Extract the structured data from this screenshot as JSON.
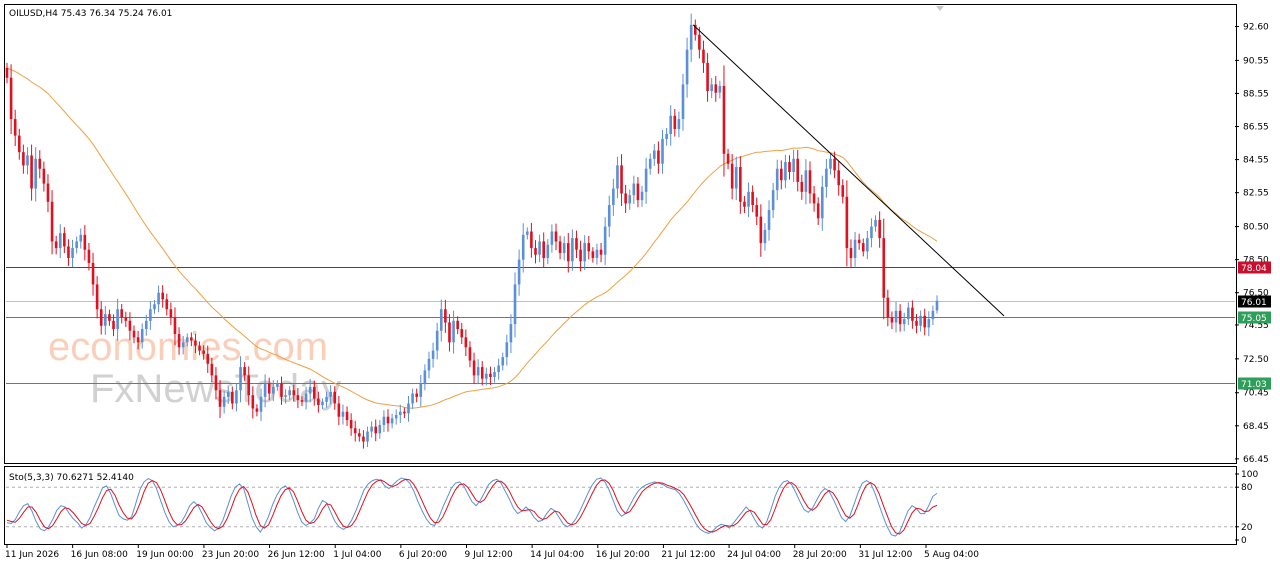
{
  "header": {
    "symbol_text": "OILUSD,H4  75.43 76.34 75.24 76.01"
  },
  "watermark": {
    "line1": "economies.com",
    "line2": "FxNewsToday"
  },
  "chart_data": {
    "type": "candlestick",
    "symbol": "OILUSD",
    "timeframe": "H4",
    "ohlc_last": {
      "open": 75.43,
      "high": 76.34,
      "low": 75.24,
      "close": 76.01
    },
    "y_ticks": [
      "92.60",
      "90.55",
      "88.55",
      "86.55",
      "84.55",
      "82.55",
      "80.50",
      "78.50",
      "76.50",
      "74.55",
      "72.50",
      "70.45",
      "68.45",
      "66.45"
    ],
    "ylim": [
      66.2,
      93.9
    ],
    "x_ticks": [
      "11 Jun 2026",
      "16 Jun 08:00",
      "19 Jun 00:00",
      "23 Jun 20:00",
      "26 Jun 12:00",
      "1 Jul 04:00",
      "6 Jul 20:00",
      "9 Jul 12:00",
      "14 Jul 04:00",
      "16 Jul 20:00",
      "21 Jul 12:00",
      "24 Jul 04:00",
      "28 Jul 20:00",
      "31 Jul 12:00",
      "5 Aug 04:00"
    ],
    "price_levels": [
      {
        "label": "78.04",
        "value": 78.04,
        "color": "#c8102e"
      },
      {
        "label": "76.01",
        "value": 76.01,
        "color": "#000000"
      },
      {
        "label": "75.05",
        "value": 75.05,
        "color": "#2e9e5b"
      },
      {
        "label": "71.03",
        "value": 71.03,
        "color": "#2e9e5b"
      }
    ],
    "trendline": {
      "from": [
        "21 Jul 12:00",
        92.7
      ],
      "to": [
        "5 Aug 04:00",
        75.1
      ],
      "color": "#000000"
    },
    "moving_average": {
      "color": "#f0a040"
    },
    "up_color": "#5b8fd8",
    "down_color": "#e0101e",
    "closes": [
      89.5,
      87.0,
      86.0,
      85.0,
      84.2,
      84.8,
      82.8,
      84.6,
      84.0,
      83.1,
      82.0,
      79.6,
      79.2,
      80.1,
      79.3,
      78.6,
      79.2,
      79.6,
      80.0,
      79.1,
      78.3,
      77.0,
      75.5,
      74.5,
      75.2,
      74.8,
      74.3,
      75.5,
      75.0,
      74.8,
      74.2,
      73.8,
      73.5,
      74.3,
      74.8,
      75.5,
      75.8,
      76.5,
      76.1,
      75.5,
      75.0,
      74.0,
      73.2,
      73.5,
      73.8,
      73.6,
      73.3,
      73.0,
      72.8,
      72.2,
      71.5,
      70.6,
      69.6,
      70.2,
      70.5,
      69.8,
      70.6,
      72.0,
      71.5,
      70.3,
      69.5,
      69.3,
      70.2,
      71.0,
      70.4,
      70.8,
      71.0,
      70.2,
      70.3,
      70.6,
      70.3,
      70.0,
      69.9,
      70.4,
      70.8,
      70.1,
      69.7,
      69.9,
      70.2,
      70.5,
      69.8,
      69.0,
      69.3,
      68.8,
      68.3,
      68.0,
      67.8,
      67.5,
      68.1,
      68.4,
      68.0,
      68.5,
      69.0,
      68.6,
      68.9,
      69.1,
      69.3,
      69.2,
      69.8,
      70.4,
      70.2,
      71.0,
      71.8,
      72.5,
      73.0,
      74.2,
      75.5,
      74.7,
      73.5,
      74.8,
      74.3,
      73.8,
      73.2,
      72.4,
      71.5,
      72.0,
      71.3,
      71.6,
      71.4,
      71.7,
      72.1,
      72.6,
      73.5,
      74.6,
      77.0,
      78.5,
      80.0,
      80.2,
      79.2,
      78.8,
      79.6,
      78.6,
      79.4,
      80.2,
      79.6,
      78.9,
      79.5,
      78.4,
      79.8,
      79.1,
      78.4,
      79.5,
      79.0,
      78.6,
      79.1,
      78.8,
      80.5,
      81.8,
      82.8,
      84.2,
      82.5,
      81.9,
      82.4,
      83.1,
      82.1,
      82.6,
      84.0,
      84.6,
      85.1,
      84.3,
      85.8,
      86.1,
      87.2,
      86.4,
      87.0,
      89.1,
      91.2,
      92.7,
      92.1,
      91.2,
      90.4,
      88.7,
      89.1,
      88.6,
      89.0,
      84.9,
      84.3,
      82.8,
      84.1,
      82.0,
      81.7,
      82.6,
      81.8,
      81.1,
      79.5,
      80.3,
      81.5,
      82.7,
      84.0,
      83.3,
      84.4,
      83.8,
      84.6,
      83.2,
      82.6,
      83.9,
      82.5,
      81.9,
      81.0,
      82.9,
      84.0,
      84.6,
      83.9,
      83.0,
      82.3,
      79.2,
      78.6,
      79.7,
      79.5,
      79.0,
      79.8,
      80.5,
      80.9,
      79.8,
      76.2,
      75.0,
      74.7,
      75.4,
      74.6,
      74.9,
      75.6,
      74.8,
      74.5,
      75.1,
      74.4,
      74.9,
      75.4,
      76.01
    ],
    "oscillator": {
      "title": "Sto(5,3,3) 70.6271 52.4140",
      "ylim": [
        0,
        100
      ],
      "ticks": [
        "100",
        "80",
        "20",
        "0"
      ],
      "levels": [
        80,
        20
      ],
      "main_color": "#5b8fd8",
      "signal_color": "#e0101e",
      "k": [
        26,
        25,
        31,
        43,
        52,
        55,
        44,
        28,
        17,
        14,
        20,
        31,
        45,
        52,
        50,
        40,
        32,
        26,
        18,
        23,
        34,
        50,
        64,
        79,
        82,
        70,
        53,
        37,
        32,
        30,
        35,
        55,
        76,
        88,
        93,
        90,
        78,
        60,
        42,
        28,
        20,
        22,
        27,
        38,
        52,
        58,
        52,
        40,
        26,
        19,
        14,
        18,
        30,
        48,
        67,
        80,
        85,
        78,
        56,
        34,
        20,
        12,
        22,
        36,
        54,
        68,
        78,
        82,
        76,
        60,
        42,
        27,
        22,
        26,
        32,
        48,
        60,
        56,
        42,
        28,
        20,
        16,
        20,
        30,
        44,
        60,
        76,
        85,
        90,
        92,
        90,
        82,
        78,
        84,
        90,
        94,
        92,
        86,
        74,
        58,
        44,
        32,
        24,
        22,
        34,
        50,
        64,
        78,
        86,
        88,
        82,
        70,
        58,
        52,
        60,
        72,
        84,
        90,
        92,
        86,
        74,
        62,
        48,
        40,
        44,
        50,
        44,
        34,
        28,
        30,
        40,
        48,
        44,
        34,
        24,
        20,
        24,
        32,
        44,
        58,
        72,
        84,
        92,
        94,
        88,
        76,
        60,
        44,
        36,
        40,
        52,
        64,
        74,
        80,
        84,
        86,
        88,
        86,
        84,
        80,
        78,
        76,
        70,
        60,
        48,
        36,
        24,
        16,
        12,
        10,
        14,
        20,
        24,
        22,
        18,
        26,
        34,
        42,
        50,
        44,
        32,
        22,
        18,
        28,
        46,
        66,
        80,
        88,
        90,
        84,
        72,
        58,
        46,
        42,
        48,
        60,
        72,
        78,
        74,
        62,
        48,
        34,
        28,
        36,
        54,
        72,
        86,
        90,
        86,
        72,
        54,
        36,
        20,
        8,
        6,
        12,
        28,
        44,
        52,
        48,
        40,
        40,
        52,
        66,
        70.6271
      ],
      "d": [
        30,
        28,
        27,
        33,
        42,
        50,
        50,
        42,
        30,
        20,
        17,
        22,
        32,
        43,
        49,
        47,
        41,
        33,
        25,
        22,
        25,
        36,
        49,
        64,
        75,
        77,
        68,
        53,
        41,
        33,
        32,
        40,
        55,
        73,
        86,
        90,
        87,
        76,
        60,
        43,
        30,
        23,
        23,
        29,
        39,
        49,
        54,
        50,
        39,
        28,
        20,
        17,
        21,
        32,
        48,
        65,
        77,
        81,
        73,
        56,
        37,
        22,
        18,
        23,
        37,
        53,
        67,
        76,
        79,
        73,
        59,
        43,
        30,
        25,
        27,
        35,
        47,
        55,
        53,
        42,
        30,
        21,
        19,
        22,
        31,
        45,
        60,
        74,
        84,
        89,
        91,
        88,
        83,
        81,
        84,
        89,
        92,
        91,
        84,
        73,
        59,
        45,
        33,
        26,
        27,
        35,
        49,
        64,
        76,
        84,
        85,
        80,
        70,
        60,
        57,
        61,
        72,
        82,
        89,
        89,
        84,
        74,
        61,
        50,
        44,
        45,
        46,
        43,
        35,
        31,
        33,
        39,
        44,
        42,
        34,
        26,
        23,
        25,
        33,
        45,
        58,
        71,
        83,
        90,
        91,
        86,
        75,
        60,
        47,
        40,
        43,
        52,
        63,
        73,
        79,
        83,
        86,
        87,
        86,
        83,
        81,
        78,
        75,
        69,
        59,
        48,
        36,
        25,
        17,
        13,
        12,
        15,
        19,
        22,
        21,
        22,
        26,
        34,
        42,
        45,
        42,
        33,
        24,
        23,
        31,
        47,
        64,
        78,
        86,
        87,
        82,
        71,
        59,
        49,
        45,
        50,
        60,
        70,
        75,
        71,
        61,
        48,
        37,
        33,
        39,
        54,
        71,
        83,
        87,
        83,
        71,
        54,
        37,
        21,
        11,
        9,
        15,
        28,
        41,
        48,
        47,
        43,
        44,
        50,
        52.414
      ]
    }
  }
}
